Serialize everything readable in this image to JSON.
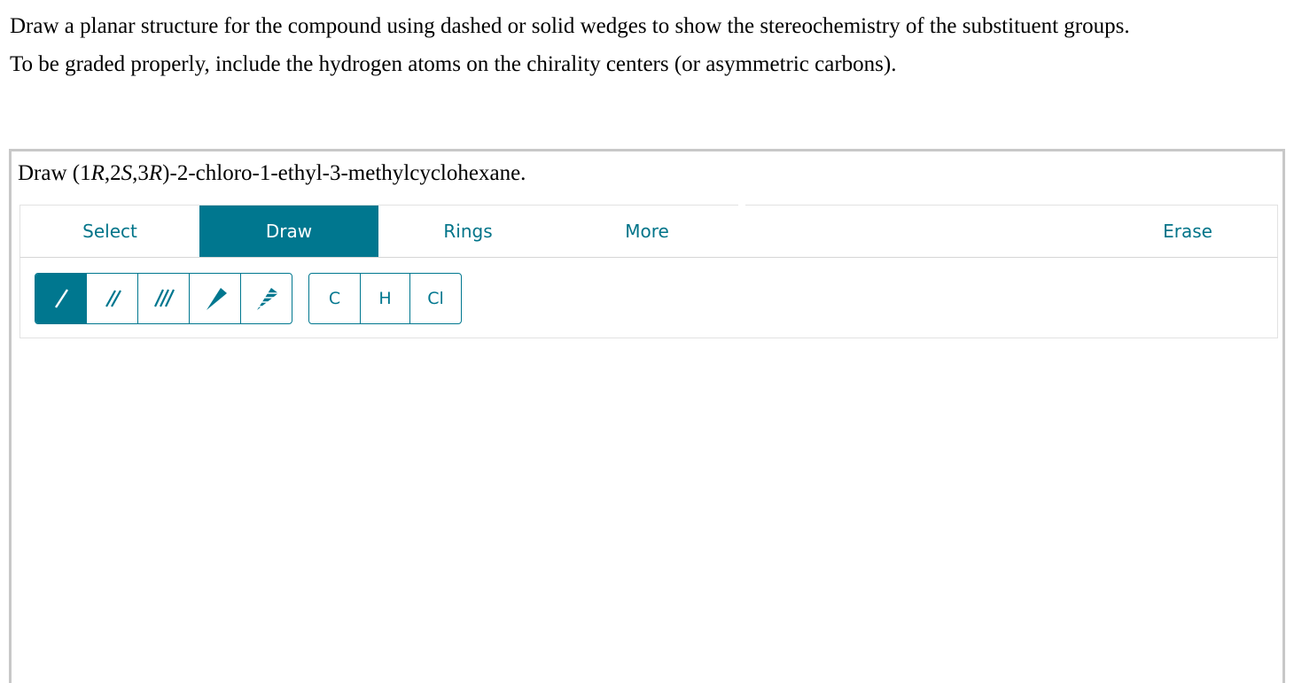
{
  "instructions": {
    "line1": "Draw a planar structure for the compound using dashed or solid wedges to show the stereochemistry of the substituent groups.",
    "line2": "To be graded properly, include the hydrogen atoms on the chirality centers (or asymmetric carbons)."
  },
  "question": {
    "prefix": "Draw (1",
    "r1": "R",
    "sep1": ",2",
    "s2": "S",
    "sep2": ",3",
    "r3": "R",
    "suffix": ")-2-chloro-1-ethyl-3-methylcyclohexane."
  },
  "tabs": {
    "select": "Select",
    "draw": "Draw",
    "rings": "Rings",
    "more": "More",
    "erase": "Erase"
  },
  "bond_tools": [
    {
      "icon": "single-bond-icon",
      "active": true
    },
    {
      "icon": "double-bond-icon",
      "active": false
    },
    {
      "icon": "triple-bond-icon",
      "active": false
    },
    {
      "icon": "solid-wedge-icon",
      "active": false
    },
    {
      "icon": "dashed-wedge-icon",
      "active": false
    }
  ],
  "atoms": {
    "carbon": "C",
    "hydrogen": "H",
    "chlorine": "Cl"
  },
  "colors": {
    "accent": "#00778f",
    "border": "#c8c8c8"
  }
}
